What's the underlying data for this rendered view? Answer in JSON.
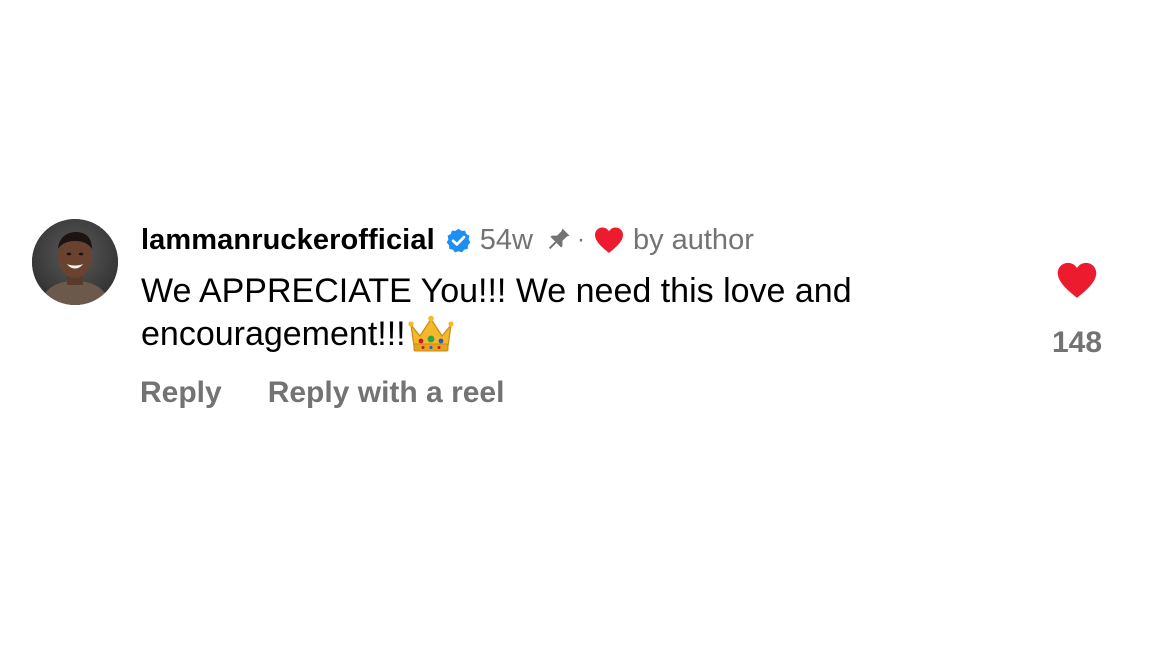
{
  "comment": {
    "username": "lammanruckerofficial",
    "verified": true,
    "time": "54w",
    "pinned": true,
    "separator": "·",
    "liked_by_author": true,
    "author_label": "by author",
    "text": "We APPRECIATE You!!! We need this love and encouragement!!!",
    "text_emoji": "crown",
    "like_count": "148",
    "liked": true
  },
  "actions": {
    "reply": "Reply",
    "reply_with_reel": "Reply with a reel"
  },
  "icons": {
    "verified": "verified-badge-icon",
    "pin": "pin-icon",
    "author_heart": "heart-icon",
    "like": "heart-icon",
    "emoji": "crown-emoji"
  },
  "colors": {
    "heart": "#ed1b2e",
    "verified": "#1d8ef2",
    "muted_text": "#737373",
    "text": "#000000",
    "background": "#ffffff"
  }
}
